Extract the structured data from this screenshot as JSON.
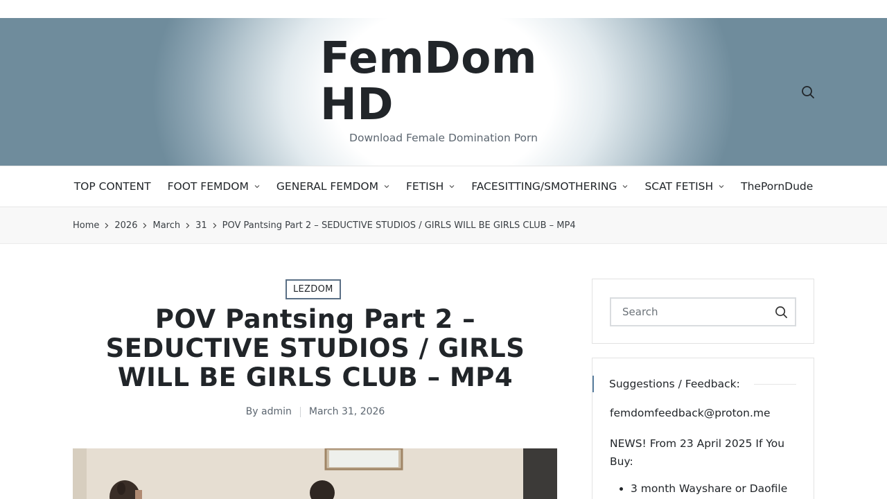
{
  "site": {
    "title": "FemDom HD",
    "tagline": "Download Female Domination Porn"
  },
  "nav": {
    "items": [
      {
        "label": "TOP CONTENT",
        "has_submenu": false
      },
      {
        "label": "FOOT FEMDOM",
        "has_submenu": true
      },
      {
        "label": "GENERAL FEMDOM",
        "has_submenu": true
      },
      {
        "label": "FETISH",
        "has_submenu": true
      },
      {
        "label": "FACESITTING/SMOTHERING",
        "has_submenu": true
      },
      {
        "label": "SCAT FETISH",
        "has_submenu": true
      },
      {
        "label": "ThePornDude",
        "has_submenu": false
      }
    ]
  },
  "breadcrumb": [
    "Home",
    "2026",
    "March",
    "31",
    "POV Pantsing Part 2 – SEDUCTIVE STUDIOS / GIRLS WILL BE GIRLS CLUB – MP4"
  ],
  "post": {
    "category": "LEZDOM",
    "title": "POV Pantsing Part 2 – SEDUCTIVE STUDIOS / GIRLS WILL BE GIRLS CLUB – MP4",
    "author_prefix": "By",
    "author": "admin",
    "date": "March 31, 2026"
  },
  "sidebar": {
    "search_placeholder": "Search",
    "feedback_title": "Suggestions / Feedback:",
    "feedback_email": "femdomfeedback@proton.me",
    "news_text": "NEWS! From 23 April 2025 If You Buy:",
    "news_items": [
      "3 month Wayshare or Daofile"
    ]
  },
  "colors": {
    "accent": "#5a7fa0",
    "badge_border": "#5a6f85",
    "text": "#212529"
  }
}
